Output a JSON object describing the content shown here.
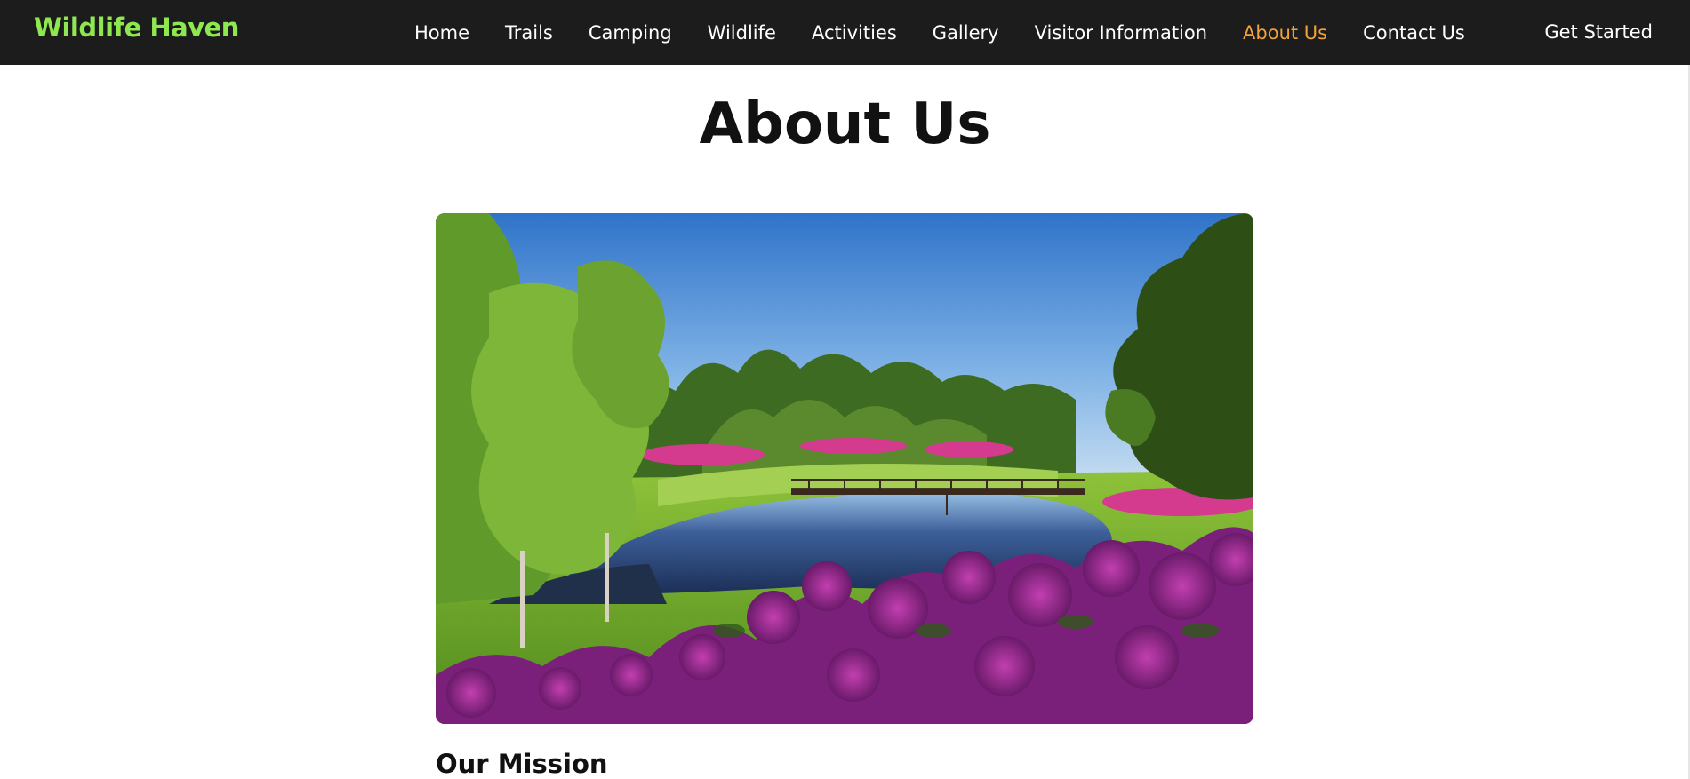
{
  "navbar": {
    "logo": "Wildlife Haven",
    "links": [
      {
        "label": "Home"
      },
      {
        "label": "Trails"
      },
      {
        "label": "Camping"
      },
      {
        "label": "Wildlife"
      },
      {
        "label": "Activities"
      },
      {
        "label": "Gallery"
      },
      {
        "label": "Visitor Information"
      },
      {
        "label": "About Us",
        "active": true
      },
      {
        "label": "Contact Us"
      }
    ],
    "cta": "Get Started",
    "colors": {
      "background": "#1c1c1c",
      "logo": "#8ee84f",
      "active_link": "#f2a23a",
      "link": "#ffffff"
    }
  },
  "main": {
    "title": "About Us",
    "hero_image": {
      "icon": "landscape-photo"
    },
    "section_heading": "Our Mission"
  }
}
